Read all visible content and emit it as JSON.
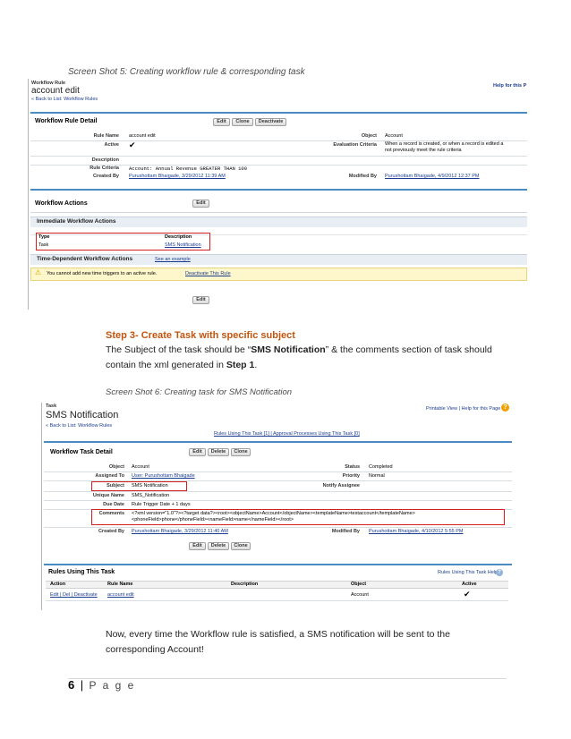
{
  "caption1": "Screen Shot 5: Creating workflow rule & corresponding task",
  "ss1": {
    "eyebrow": "Workflow Rule",
    "title": "account edit",
    "back_link": "« Back to List: Workflow Rules",
    "help_link": "Help for this P",
    "detail_header": "Workflow Rule Detail",
    "buttons": [
      "Edit",
      "Clone",
      "Deactivate"
    ],
    "rule_name_label": "Rule Name",
    "rule_name": "account edit",
    "object_label": "Object",
    "object": "Account",
    "active_label": "Active",
    "active_check": "✔",
    "eval_label": "Evaluation Criteria",
    "eval_line1": "When a record is created, or when a record is edited a",
    "eval_line2": "not previously meet the rule criteria",
    "description_label": "Description",
    "criteria_label": "Rule Criteria",
    "criteria": "Account: Annual Revenue GREATER THAN 100",
    "created_label": "Created By",
    "created": "Purushottam Bhaigade, 3/29/2012 11:39 AM",
    "modified_label": "Modified By",
    "modified": "Purushottam Bhaigade, 4/9/2012 12:37 PM",
    "actions_header": "Workflow Actions",
    "edit_btn": "Edit",
    "immediate_header": "Immediate Workflow Actions",
    "col_type": "Type",
    "col_description": "Description",
    "row_type": "Task",
    "row_description": "SMS Notification",
    "time_header": "Time-Dependent Workflow Actions",
    "see_example": "See an example",
    "warning": "You cannot add new time triggers to an active rule.",
    "deactivate_link": "Deactivate This Rule",
    "edit_btn2": "Edit"
  },
  "step": {
    "title": "Step 3- Create Task with specific subject",
    "line1_a": "The Subject of the task should be “",
    "line1_bold": "SMS Notification",
    "line1_b": "” & the comments section of task should",
    "line2_a": "contain the xml generated in ",
    "line2_bold": "Step 1",
    "line2_b": "."
  },
  "caption2": "Screen Shot 6: Creating task for SMS Notification",
  "ss2": {
    "eyebrow": "Task",
    "title": "SMS Notification",
    "back_link": "« Back to List: Workflow Rules",
    "help_links": "Printable View | Help for this Page",
    "rules_links": "Rules Using This Task [1]   |   Approval Processes Using This Task [0]",
    "detail_header": "Workflow Task Detail",
    "buttons": [
      "Edit",
      "Delete",
      "Clone"
    ],
    "object_label": "Object",
    "object": "Account",
    "status_label": "Status",
    "status": "Completed",
    "assigned_label": "Assigned To",
    "assigned": "User: Purushottam Bhaigade",
    "priority_label": "Priority",
    "priority": "Normal",
    "subject_label": "Subject",
    "subject": "SMS Notification",
    "notify_label": "Notify Assignee",
    "unique_label": "Unique Name",
    "unique": "SMS_Notification",
    "due_label": "Due Date",
    "due": "Rule Trigger Date + 1 days",
    "comments_label": "Comments",
    "comments1": "<?xml version=\"1.0\"?><?target data?><root><objectName>Account</objectName><templateName>testaccount</templateName>",
    "comments2": "<phoneField>phone</phoneField><nameField>name</nameField></root>",
    "created_label": "Created By",
    "created": "Purushottam Bhaigade, 3/29/2012 11:40 AM",
    "modified_label": "Modified By",
    "modified": "Purushottam Bhaigade, 4/10/2012 5:55 PM",
    "rules_header": "Rules Using This Task",
    "rules_help": "Rules Using This Task Help",
    "col_action": "Action",
    "col_rule": "Rule Name",
    "col_desc": "Description",
    "col_object": "Object",
    "col_active": "Active",
    "row_actions": "Edit | Del | Deactivate",
    "row_rule": "account edit",
    "row_object": "Account",
    "row_active": "✔"
  },
  "closing": {
    "line1": "Now, every time the Workflow rule is satisfied, a SMS notification will be sent to the",
    "line2": "corresponding Account!"
  },
  "footer": {
    "page_number": "6",
    "separator": "|",
    "page_word": "P a g e"
  }
}
